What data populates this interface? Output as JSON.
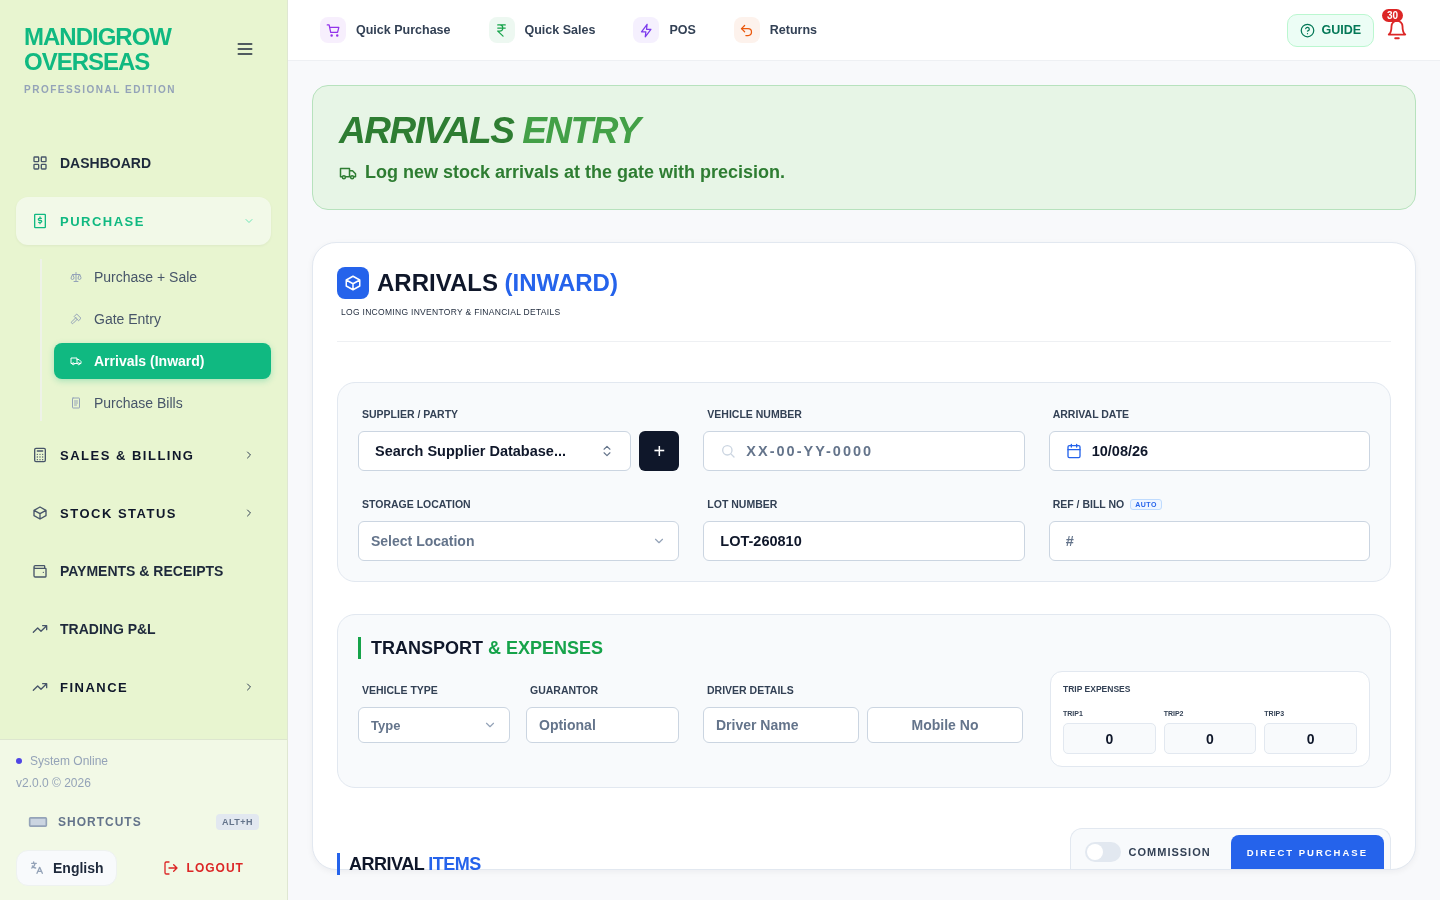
{
  "sidebar": {
    "brand": [
      "MANDIGROW",
      "OVERSEAS"
    ],
    "edition": "PROFESSIONAL EDITION",
    "items": [
      {
        "label": "DASHBOARD",
        "has_submenu": false,
        "expanded": false
      },
      {
        "label": "PURCHASE",
        "has_submenu": true,
        "expanded": true,
        "children": [
          {
            "label": "Purchase + Sale",
            "selected": false
          },
          {
            "label": "Gate Entry",
            "selected": false
          },
          {
            "label": "Arrivals (Inward)",
            "selected": true
          },
          {
            "label": "Purchase Bills",
            "selected": false
          }
        ]
      },
      {
        "label": "SALES & BILLING",
        "has_submenu": true,
        "expanded": false
      },
      {
        "label": "STOCK STATUS",
        "has_submenu": true,
        "expanded": false
      },
      {
        "label": "PAYMENTS & RECEIPTS",
        "has_submenu": false,
        "expanded": false
      },
      {
        "label": "TRADING P&L",
        "has_submenu": false,
        "expanded": false
      },
      {
        "label": "FINANCE",
        "has_submenu": true,
        "expanded": false
      }
    ],
    "status": "System Online",
    "version": "v2.0.0 © 2026",
    "shortcuts": "SHORTCUTS",
    "shortcut_key": "ALT+H",
    "language": "English",
    "logout": "LOGOUT"
  },
  "topbar": {
    "links": [
      {
        "label": "Quick Purchase",
        "color": "#9333ea"
      },
      {
        "label": "Quick Sales",
        "color": "#16a34a"
      },
      {
        "label": "POS",
        "color": "#7c3aed"
      },
      {
        "label": "Returns",
        "color": "#ea580c"
      }
    ],
    "guide": "GUIDE",
    "notifications": "30"
  },
  "banner": {
    "title": [
      "ARRIVALS",
      "ENTRY"
    ],
    "subtitle": "Log new stock arrivals at the gate with precision."
  },
  "form": {
    "title": [
      "ARRIVALS",
      "(INWARD)"
    ],
    "subtitle": "LOG INCOMING INVENTORY & FINANCIAL DETAILS",
    "fields": [
      {
        "label": "SUPPLIER / PARTY",
        "kind": "combo",
        "value": "Search Supplier Database...",
        "add": "+"
      },
      {
        "label": "VEHICLE NUMBER",
        "kind": "search",
        "placeholder": "XX-00-YY-0000"
      },
      {
        "label": "ARRIVAL DATE",
        "kind": "date",
        "value": "10/08/26"
      },
      {
        "label": "STORAGE LOCATION",
        "kind": "select",
        "placeholder": "Select Location"
      },
      {
        "label": "LOT NUMBER",
        "kind": "text",
        "value": "LOT-260810"
      },
      {
        "label": "REF / BILL NO",
        "kind": "text",
        "placeholder": "#",
        "badge": "AUTO"
      }
    ]
  },
  "transport": {
    "title": [
      "TRANSPORT",
      "& EXPENSES"
    ],
    "vehicle_type": {
      "label": "VEHICLE TYPE",
      "placeholder": "Type"
    },
    "guarantor": {
      "label": "GUARANTOR",
      "placeholder": "Optional"
    },
    "driver": {
      "label": "DRIVER DETAILS",
      "name_placeholder": "Driver Name",
      "mobile_placeholder": "Mobile No"
    },
    "trips": {
      "title": "TRIP EXPENSES",
      "items": [
        {
          "label": "TRIP1",
          "value": "0"
        },
        {
          "label": "TRIP2",
          "value": "0"
        },
        {
          "label": "TRIP3",
          "value": "0"
        }
      ]
    }
  },
  "items": {
    "title": [
      "ARRIVAL",
      "ITEMS"
    ],
    "commission": {
      "label": "COMMISSION",
      "on": false
    },
    "direct_purchase": "DIRECT PURCHASE"
  }
}
